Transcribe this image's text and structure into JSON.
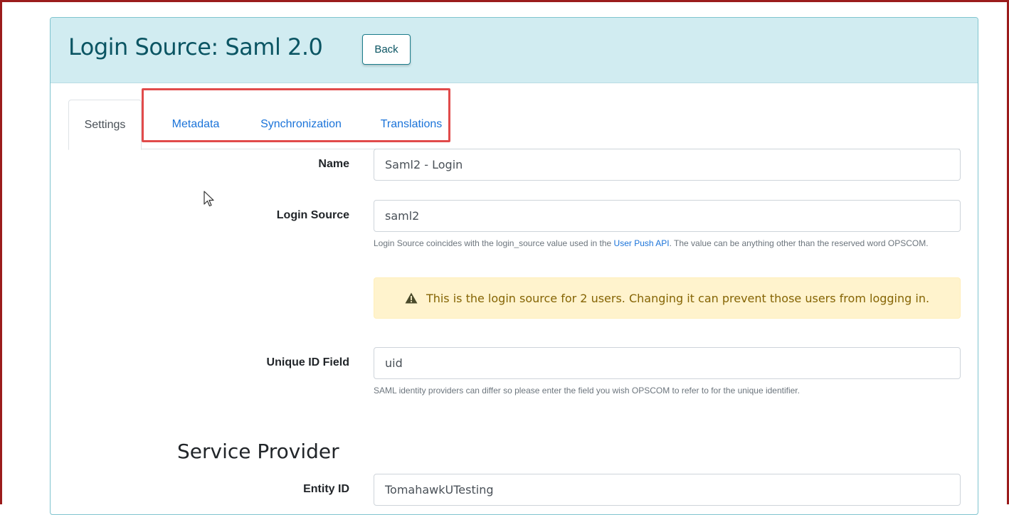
{
  "header": {
    "title": "Login Source: Saml 2.0",
    "back_label": "Back"
  },
  "tabs": [
    {
      "label": "Settings",
      "active": true
    },
    {
      "label": "Metadata",
      "active": false
    },
    {
      "label": "Synchronization",
      "active": false
    },
    {
      "label": "Translations",
      "active": false
    }
  ],
  "form": {
    "name": {
      "label": "Name",
      "value": "Saml2 - Login"
    },
    "login_source": {
      "label": "Login Source",
      "value": "saml2",
      "help_before": "Login Source coincides with the login_source value used in the ",
      "help_link": "User Push API",
      "help_after": ". The value can be anything other than the reserved word OPSCOM."
    },
    "alert": {
      "icon": "warning-triangle-icon",
      "text": "This is the login source for 2 users. Changing it can prevent those users from logging in."
    },
    "unique_id": {
      "label": "Unique ID Field",
      "value": "uid",
      "help": "SAML identity providers can differ so please enter the field you wish OPSCOM to refer to for the unique identifier."
    }
  },
  "service_provider": {
    "heading": "Service Provider",
    "entity_id": {
      "label": "Entity ID",
      "value": "TomahawkUTesting"
    }
  },
  "colors": {
    "header_bg": "#d1ecf1",
    "title": "#0b5563",
    "link": "#1a73d9",
    "highlight": "#e14b4b",
    "frame": "#9b1c1c",
    "alert_bg": "#fff3cd",
    "alert_text": "#856404"
  }
}
